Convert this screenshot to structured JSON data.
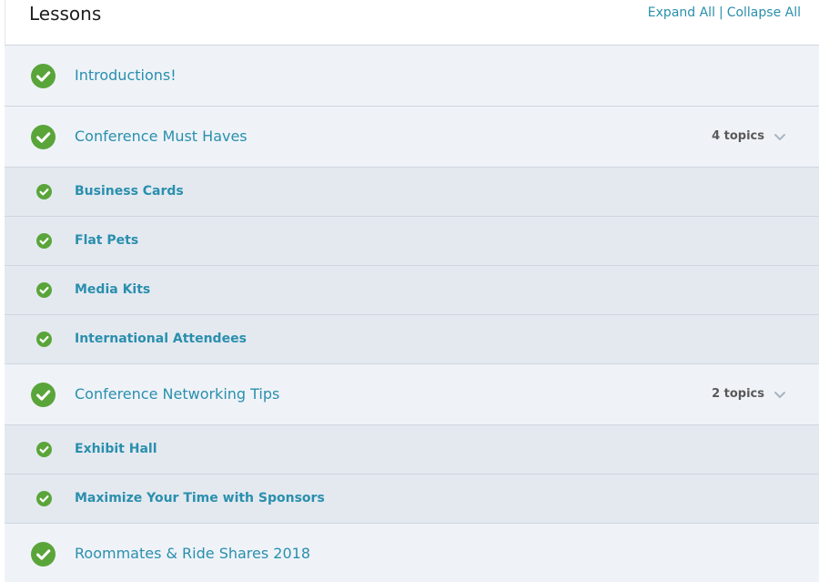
{
  "header": {
    "title": "Lessons",
    "expand_all": "Expand All",
    "separator": "|",
    "collapse_all": "Collapse All"
  },
  "lessons": [
    {
      "title": "Introductions!",
      "completed": true,
      "topics_label": "",
      "topics": []
    },
    {
      "title": "Conference Must Haves",
      "completed": true,
      "topics_label": "4 topics",
      "topics": [
        {
          "title": "Business Cards",
          "completed": true
        },
        {
          "title": "Flat Pets",
          "completed": true
        },
        {
          "title": "Media Kits",
          "completed": true
        },
        {
          "title": "International Attendees",
          "completed": true
        }
      ]
    },
    {
      "title": "Conference Networking Tips",
      "completed": true,
      "topics_label": "2 topics",
      "topics": [
        {
          "title": "Exhibit Hall",
          "completed": true
        },
        {
          "title": "Maximize Your Time with Sponsors",
          "completed": true
        }
      ]
    },
    {
      "title": "Roommates & Ride Shares 2018",
      "completed": true,
      "topics_label": "",
      "topics": []
    }
  ],
  "colors": {
    "accent": "#2a8fad",
    "check": "#5aa53a",
    "lesson_bg": "#eff3f8",
    "topic_bg": "#e4e9f0"
  },
  "icons": {
    "completed": "checkmark-circle-icon",
    "expand": "chevron-down-icon"
  }
}
